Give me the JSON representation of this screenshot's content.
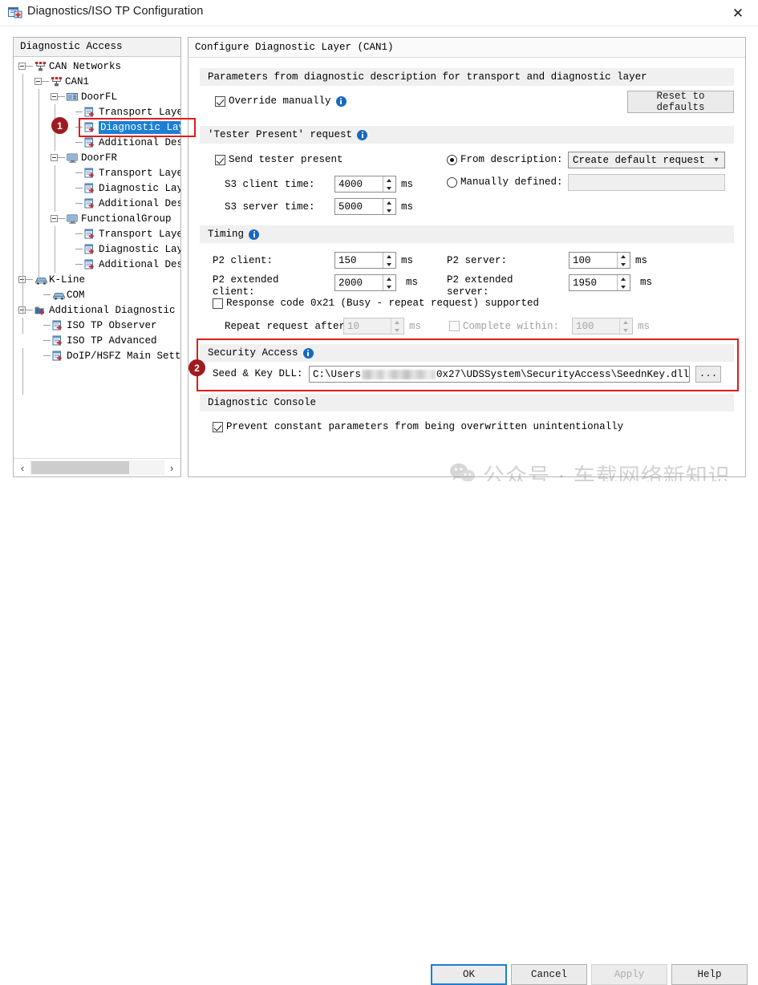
{
  "window": {
    "title": "Diagnostics/ISO TP Configuration",
    "icon": "config-document-add-icon",
    "close_label": "✕"
  },
  "tree_panel": {
    "header": "Diagnostic Access",
    "nodes": [
      {
        "label": "CAN Networks",
        "depth": 0,
        "icon": "network-icon",
        "expander": "minus",
        "selected": false
      },
      {
        "label": "CAN1",
        "depth": 1,
        "icon": "network-icon",
        "expander": "minus",
        "selected": false
      },
      {
        "label": "DoorFL",
        "depth": 2,
        "icon": "ecu-blue-icon",
        "expander": "minus",
        "selected": false
      },
      {
        "label": "Transport Layer",
        "depth": 3,
        "icon": "layer-add-icon",
        "expander": "none",
        "selected": false
      },
      {
        "label": "Diagnostic Layer",
        "depth": 3,
        "icon": "layer-add-icon",
        "expander": "none",
        "selected": true
      },
      {
        "label": "Additional Descr",
        "depth": 3,
        "icon": "layer-add-icon",
        "expander": "none",
        "selected": false
      },
      {
        "label": "DoorFR",
        "depth": 2,
        "icon": "ecu-icon",
        "expander": "minus",
        "selected": false
      },
      {
        "label": "Transport Layer",
        "depth": 3,
        "icon": "layer-add-icon",
        "expander": "none",
        "selected": false
      },
      {
        "label": "Diagnostic Laye",
        "depth": 3,
        "icon": "layer-add-icon",
        "expander": "none",
        "selected": false
      },
      {
        "label": "Additional Desc",
        "depth": 3,
        "icon": "layer-add-icon",
        "expander": "none",
        "selected": false
      },
      {
        "label": "FunctionalGroup",
        "depth": 2,
        "icon": "ecu-icon",
        "expander": "minus",
        "selected": false
      },
      {
        "label": "Transport Layer",
        "depth": 3,
        "icon": "layer-add-icon",
        "expander": "none",
        "selected": false
      },
      {
        "label": "Diagnostic Laye",
        "depth": 3,
        "icon": "layer-add-icon",
        "expander": "none",
        "selected": false
      },
      {
        "label": "Additional Desc",
        "depth": 3,
        "icon": "layer-add-icon",
        "expander": "none",
        "selected": false
      },
      {
        "label": "K-Line",
        "depth": 0,
        "icon": "car-icon",
        "expander": "minus",
        "selected": false
      },
      {
        "label": "COM",
        "depth": 1,
        "icon": "car-icon",
        "expander": "none",
        "selected": false
      },
      {
        "label": "Additional Diagnostic Se",
        "depth": 0,
        "icon": "folder-add-icon",
        "expander": "minus",
        "selected": false
      },
      {
        "label": "ISO TP Observer",
        "depth": 1,
        "icon": "layer-add-icon",
        "expander": "none",
        "selected": false
      },
      {
        "label": "ISO TP Advanced",
        "depth": 1,
        "icon": "layer-add-icon",
        "expander": "none",
        "selected": false
      },
      {
        "label": "DoIP/HSFZ Main Settin",
        "depth": 1,
        "icon": "layer-add-icon",
        "expander": "none",
        "selected": false
      }
    ],
    "scroll_left_icon": "‹",
    "scroll_right_icon": "›"
  },
  "config_panel": {
    "header": "Configure Diagnostic Layer (CAN1)",
    "params_group": {
      "title": "Parameters from diagnostic description for transport and diagnostic layer",
      "override_manually": {
        "label": "Override manually",
        "checked": true
      },
      "reset_button": {
        "line1": "Reset to",
        "line2": "defaults"
      }
    },
    "tester_present_group": {
      "title": "'Tester Present' request",
      "send_tester_present": {
        "label": "Send tester present",
        "checked": true
      },
      "s3_client": {
        "label": "S3 client time:",
        "value": "4000",
        "unit": "ms"
      },
      "s3_server": {
        "label": "S3 server time:",
        "value": "5000",
        "unit": "ms"
      },
      "from_description": {
        "label": "From description:",
        "selected": true,
        "value": "Create default request"
      },
      "manually_defined": {
        "label": "Manually defined:",
        "selected": false,
        "value": ""
      }
    },
    "timing_group": {
      "title": "Timing",
      "p2_client": {
        "label": "P2 client:",
        "value": "150",
        "unit": "ms"
      },
      "p2_server": {
        "label": "P2 server:",
        "value": "100",
        "unit": "ms"
      },
      "p2_ext_client": {
        "label_line1": "P2 extended",
        "label_line2": "client:",
        "value": "2000",
        "unit": "ms"
      },
      "p2_ext_server": {
        "label_line1": "P2 extended",
        "label_line2": "server:",
        "value": "1950",
        "unit": "ms"
      },
      "response_code": {
        "label": "Response code 0x21 (Busy - repeat request) supported",
        "checked": false
      },
      "repeat_request_after": {
        "label": "Repeat request after:",
        "value": "10",
        "unit": "ms",
        "disabled": true
      },
      "complete_within": {
        "label": "Complete within:",
        "value": "100",
        "unit": "ms",
        "checked": false,
        "disabled": true
      }
    },
    "security_group": {
      "title": "Security Access",
      "seed_key_label": "Seed & Key DLL:",
      "seed_key_path_prefix": "C:\\Users",
      "seed_key_path_suffix": "0x27\\UDSSystem\\SecurityAccess\\SeednKey.dll",
      "browse_button": "..."
    },
    "console_group": {
      "title": "Diagnostic Console",
      "prevent_overwrite": {
        "label": "Prevent constant parameters from being overwritten unintentionally",
        "checked": true
      }
    }
  },
  "footer": {
    "ok": "OK",
    "cancel": "Cancel",
    "apply": "Apply",
    "help": "Help"
  },
  "annotations": [
    {
      "number": "1",
      "target": "tree-diagnostic-layer"
    },
    {
      "number": "2",
      "target": "security-access-group"
    }
  ],
  "watermark": {
    "text": "公众号 · 车载网络新知识",
    "icon": "wechat-icon"
  },
  "colors": {
    "selection_blue": "#1b7fd4",
    "annotation_red": "#e01b1b",
    "badge_red": "#9e1b20",
    "info_blue": "#1669c1",
    "group_bar": "#f0f0f0"
  }
}
